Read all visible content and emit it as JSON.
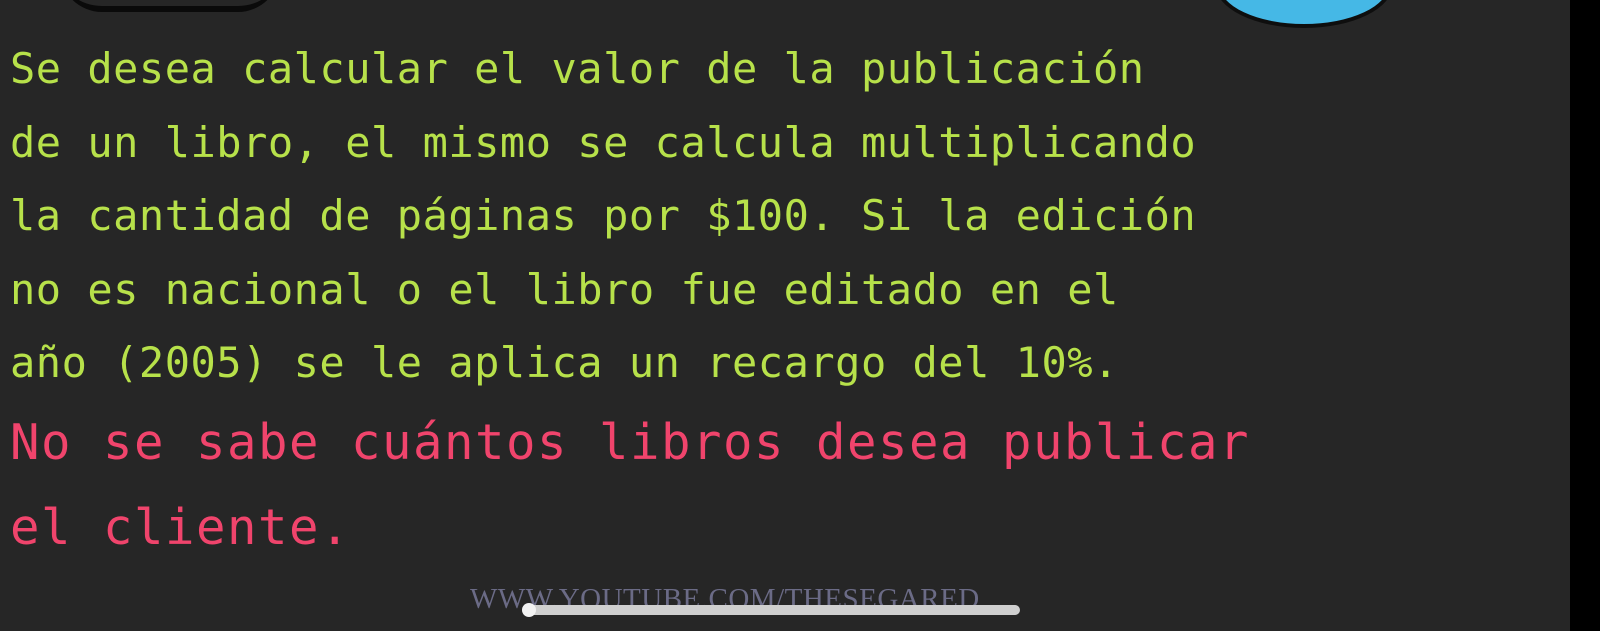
{
  "text": {
    "green_lines": [
      "Se desea calcular el valor de la publicación",
      "de un libro, el mismo se calcula multiplicando",
      "la cantidad de páginas por $100. Si la edición",
      "no es nacional o el libro fue editado en el",
      "año (2005) se le aplica un recargo del 10%."
    ],
    "red_lines": [
      "No se sabe cuántos libros desea publicar",
      "el cliente."
    ]
  },
  "watermark": "WWW.YOUTUBE.COM/THESEGARED",
  "colors": {
    "background": "#262626",
    "green_text": "#b7e14a",
    "red_text": "#f0446c",
    "blob": "#45b8e6"
  },
  "playback": {
    "progress": 0.0
  }
}
